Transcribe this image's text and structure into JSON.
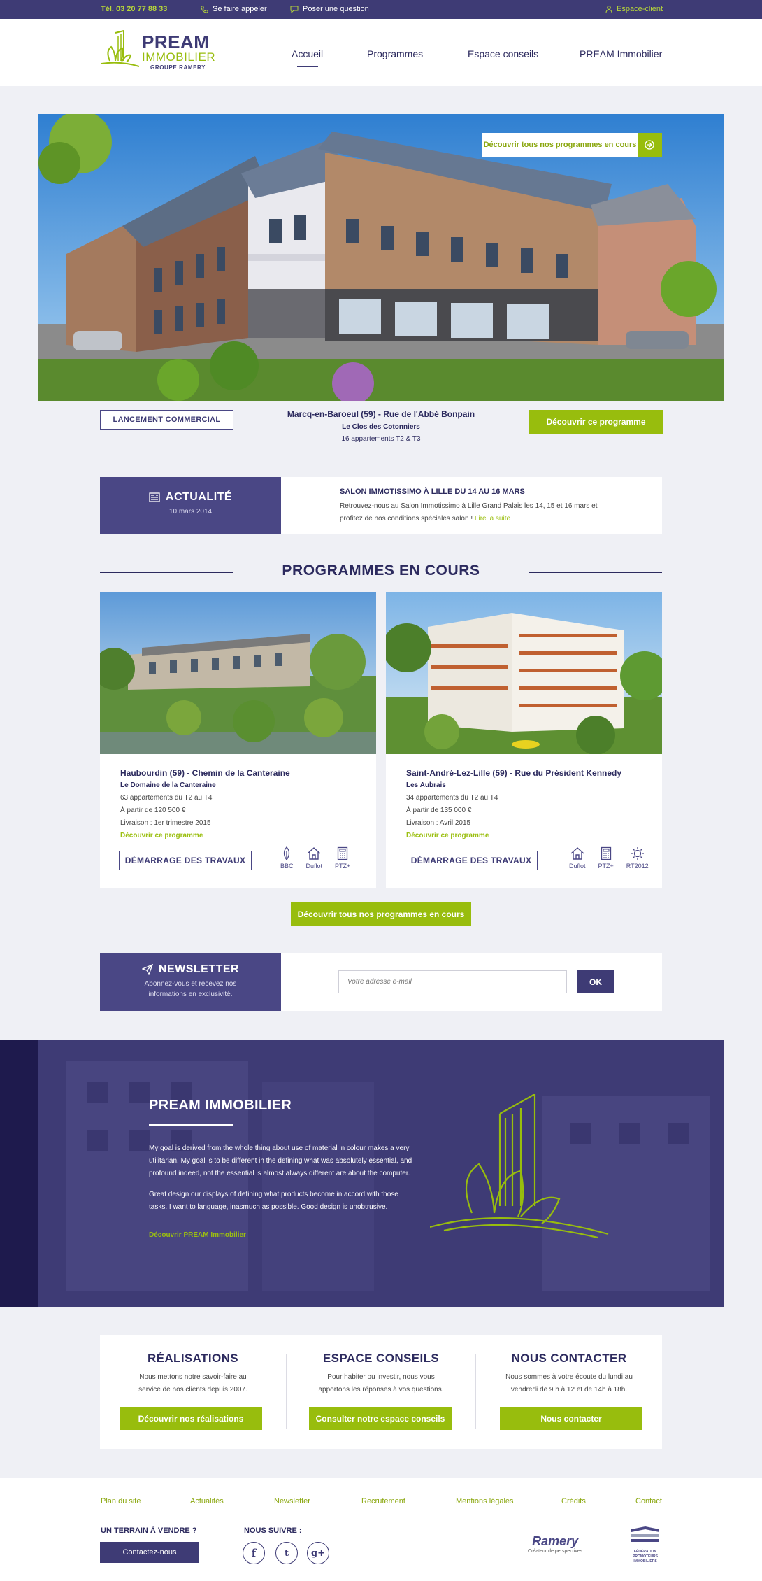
{
  "topbar": {
    "phone": "Tél. 03 20 77 88 33",
    "call_back": "Se faire appeler",
    "ask_question": "Poser une question",
    "client_space": "Espace-client"
  },
  "brand": {
    "name_line1": "PREAM",
    "name_line2": "IMMOBILIER",
    "group": "GROUPE RAMERY"
  },
  "nav": {
    "items": [
      "Accueil",
      "Programmes",
      "Espace conseils",
      "PREAM Immobilier"
    ]
  },
  "hero": {
    "all_programs_label": "Découvrir tous nos programmes en cours",
    "badge": "LANCEMENT COMMERCIAL",
    "location": "Marcq-en-Baroeul (59) - Rue de l'Abbé Bonpain",
    "residence": "Le Clos des Cotonniers",
    "apartments": "16 appartements T2 & T3",
    "cta": "Découvrir ce programme"
  },
  "news": {
    "heading": "ACTUALITÉ",
    "date": "10 mars 2014",
    "title": "SALON IMMOTISSIMO À LILLE DU 14 AU 16 MARS",
    "body_line1": "Retrouvez-nous au Salon Immotissimo à Lille Grand Palais les 14, 15 et 16 mars et",
    "body_line2": "profitez de nos conditions spéciales salon !",
    "read_more": "Lire la suite"
  },
  "programs": {
    "section_title": "PROGRAMMES EN COURS",
    "items": [
      {
        "title": "Haubourdin (59) - Chemin de la Canteraine",
        "residence": "Le Domaine de la Canteraine",
        "apartments": "63 appartements du T2 au T4",
        "price": "À partir de 120 500 €",
        "delivery": "Livraison : 1er trimestre 2015",
        "link": "Découvrir ce programme",
        "status": "DÉMARRAGE DES TRAVAUX",
        "labels": [
          "BBC",
          "Duflot",
          "PTZ+"
        ]
      },
      {
        "title": "Saint-André-Lez-Lille (59) - Rue du Président Kennedy",
        "residence": "Les Aubrais",
        "apartments": "34 appartements du T2 au T4",
        "price": "À partir de 135 000 €",
        "delivery": "Livraison : Avril 2015",
        "link": "Découvrir ce programme",
        "status": "DÉMARRAGE DES TRAVAUX",
        "labels": [
          "Duflot",
          "PTZ+",
          "RT2012"
        ]
      }
    ],
    "all_button": "Découvrir tous nos programmes en cours"
  },
  "newsletter": {
    "heading": "NEWSLETTER",
    "sub_line1": "Abonnez-vous et recevez nos",
    "sub_line2": "informations en exclusivité.",
    "placeholder": "Votre adresse e-mail",
    "submit": "OK"
  },
  "about": {
    "title": "PREAM IMMOBILIER",
    "p1_line1": "My goal is derived from the whole thing about use of material in colour makes a very",
    "p1_line2": "utilitarian. My goal is to be different in the defining what was absolutely essential, and",
    "p1_line3": "profound indeed, not the essential is almost always different are about the computer.",
    "p2_line1": "Great design our displays of defining what products become in accord with those",
    "p2_line2": "tasks. I want to language, inasmuch as possible. Good design is unobtrusive.",
    "link": "Découvrir PREAM Immobilier"
  },
  "blocks": [
    {
      "title": "RÉALISATIONS",
      "line1": "Nous mettons notre savoir-faire au",
      "line2": "service de nos clients depuis 2007.",
      "button": "Découvrir nos réalisations"
    },
    {
      "title": "ESPACE CONSEILS",
      "line1": "Pour habiter ou investir, nous vous",
      "line2": "apportons les réponses à vos questions.",
      "button": "Consulter notre espace conseils"
    },
    {
      "title": "NOUS CONTACTER",
      "line1": "Nous sommes à votre écoute du lundi au",
      "line2": "vendredi de 9 h à 12 et de 14h à 18h.",
      "button": "Nous contacter"
    }
  ],
  "footer": {
    "links": [
      "Plan du site",
      "Actualités",
      "Newsletter",
      "Recrutement",
      "Mentions légales",
      "Crédits",
      "Contact"
    ],
    "land_title": "UN TERRAIN À VENDRE ?",
    "land_button": "Contactez-nous",
    "follow_title": "NOUS SUIVRE :",
    "social": [
      "f",
      "t",
      "g+"
    ],
    "ramery": "Ramery",
    "ramery_sub": "Créateur de perspectives",
    "fpi_line1": "FÉDÉRATION",
    "fpi_line2": "PROMOTEURS",
    "fpi_line3": "IMMOBILIERS"
  },
  "colors": {
    "primary": "#3e3b75",
    "accent": "#98bd0d",
    "background": "#eff0f5"
  }
}
